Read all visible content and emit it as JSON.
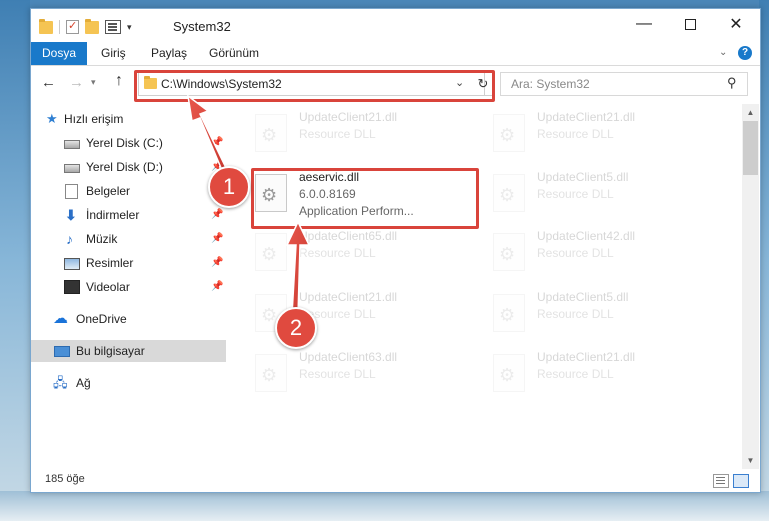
{
  "window": {
    "title": "System32",
    "min_symbol": "—",
    "close_symbol": "✕"
  },
  "ribbon": {
    "tabs": [
      "Dosya",
      "Giriş",
      "Paylaş",
      "Görünüm"
    ],
    "help_symbol": "?"
  },
  "address": {
    "path": "C:\\Windows\\System32",
    "search_placeholder": "Ara: System32"
  },
  "nav_pane": {
    "items": [
      {
        "label": "Hızlı erişim",
        "icon": "star-icon"
      },
      {
        "label": "Yerel Disk (C:)",
        "icon": "drive-icon"
      },
      {
        "label": "Yerel Disk (D:)",
        "icon": "drive-icon"
      },
      {
        "label": "Belgeler",
        "icon": "document-icon"
      },
      {
        "label": "İndirmeler",
        "icon": "download-icon"
      },
      {
        "label": "Müzik",
        "icon": "music-icon"
      },
      {
        "label": "Resimler",
        "icon": "pictures-icon"
      },
      {
        "label": "Videolar",
        "icon": "video-icon"
      },
      {
        "label": "OneDrive",
        "icon": "cloud-icon"
      },
      {
        "label": "Bu bilgisayar",
        "icon": "pc-icon"
      },
      {
        "label": "Ağ",
        "icon": "network-icon"
      }
    ]
  },
  "files": {
    "left": [
      {
        "name": "UpdateClient21.dll",
        "type": "Resource DLL"
      },
      {
        "name": "aeservic.dll",
        "version": "6.0.0.8169",
        "description": "Application Perform..."
      },
      {
        "name": "UpdateClient65.dll",
        "type": "Resource DLL"
      },
      {
        "name": "UpdateClient21.dll",
        "type": "Resource DLL"
      },
      {
        "name": "UpdateClient63.dll",
        "type": "Resource DLL"
      }
    ],
    "right": [
      {
        "name": "UpdateClient21.dll",
        "type": "Resource DLL"
      },
      {
        "name": "UpdateClient5.dll",
        "type": "Resource DLL"
      },
      {
        "name": "UpdateClient42.dll",
        "type": "Resource DLL"
      },
      {
        "name": "UpdateClient5.dll",
        "type": "Resource DLL"
      },
      {
        "name": "UpdateClient21.dll",
        "type": "Resource DLL"
      }
    ]
  },
  "status": {
    "item_count": "185 öğe"
  },
  "annotations": {
    "badge_1": "1",
    "badge_2": "2",
    "color": "#d9443b"
  }
}
